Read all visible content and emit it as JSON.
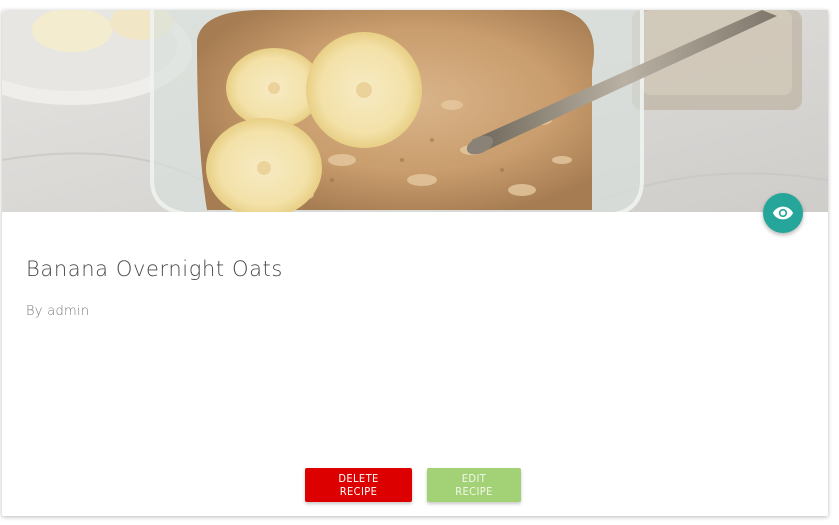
{
  "recipe": {
    "title": "Banana Overnight Oats",
    "author": "By admin"
  },
  "actions": {
    "delete_label": "DELETE RECIPE",
    "edit_label": "EDIT RECIPE"
  },
  "icons": {
    "view": "eye-icon"
  },
  "colors": {
    "view_button": "#26a69a",
    "delete_button": "#dd0000",
    "edit_button": "#a3d175"
  }
}
